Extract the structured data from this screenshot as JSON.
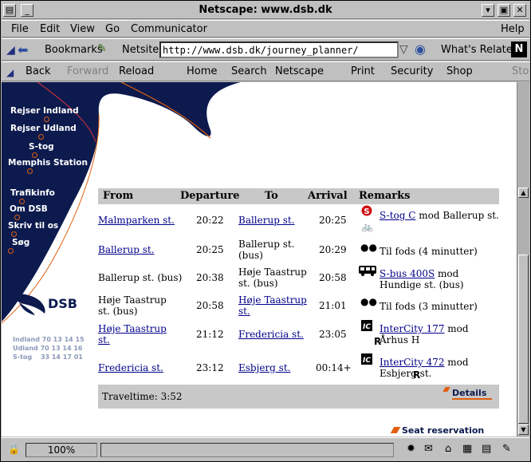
{
  "window": {
    "title": "Netscape: www.dsb.dk"
  },
  "menubar": {
    "items": [
      "File",
      "Edit",
      "View",
      "Go",
      "Communicator",
      "Help"
    ]
  },
  "location": {
    "bookmarks_label": "Bookmarks",
    "netsite_label": "Netsite:",
    "url": "http://www.dsb.dk/journey_planner/",
    "whats_related": "What's Related"
  },
  "nav": {
    "items": [
      "Back",
      "Forward",
      "Reload",
      "Home",
      "Search",
      "Netscape",
      "Print",
      "Security",
      "Shop",
      "Sto"
    ]
  },
  "sidebar": {
    "links": [
      "Rejser Indland",
      "Rejser Udland",
      "S-tog",
      "Memphis Station",
      "Trafikinfo",
      "Om DSB",
      "Skriv til os",
      "Søg"
    ],
    "logo_text": "DSB",
    "phones": [
      {
        "label": "Indland",
        "number": "70 13 14 15"
      },
      {
        "label": "Udland",
        "number": "70 13 14 16"
      },
      {
        "label": "S-tog",
        "number": "33 14 17 01"
      }
    ]
  },
  "table": {
    "headers": [
      "From",
      "Departure",
      "To",
      "Arrival",
      "Remarks"
    ],
    "rows": [
      {
        "from": "Malmparken st.",
        "dep": "20:22",
        "to": "Ballerup st.",
        "arr": "20:25",
        "remark_link": "S-tog C",
        "remark_text": " mod Ballerup st."
      },
      {
        "from": "Ballerup st.",
        "dep": "20:25",
        "to": "Ballerup st. (bus)",
        "arr": "20:29",
        "remark_link": "",
        "remark_text": "Til fods (4 minutter)"
      },
      {
        "from": "Ballerup st. (bus)",
        "dep": "20:38",
        "to": "Høje Taastrup st. (bus)",
        "arr": "20:58",
        "remark_link": "S-bus 400S",
        "remark_text": " mod Hundige st. (bus)"
      },
      {
        "from": "Høje Taastrup st. (bus)",
        "dep": "20:58",
        "to": "Høje Taastrup st.",
        "arr": "21:01",
        "remark_link": "",
        "remark_text": "Til fods (3 minutter)"
      },
      {
        "from": "Høje Taastrup st.",
        "dep": "21:12",
        "to": "Fredericia st.",
        "arr": "23:05",
        "remark_link": "InterCity 177",
        "remark_text": " mod Århus H",
        "remark_badge": "R"
      },
      {
        "from": "Fredericia st.",
        "dep": "23:12",
        "to": "Esbjerg st.",
        "arr": "00:14+",
        "remark_link": "InterCity 472",
        "remark_text": " mod Esbjerg st.",
        "remark_badge": "R"
      }
    ],
    "traveltime": "Traveltime: 3:52",
    "details_label": "Details",
    "seat_label": "Seat reservation"
  },
  "status": {
    "zoom": "100%"
  },
  "colors": {
    "navy": "#0c1a4e",
    "orange": "#e06010",
    "link": "#00008b",
    "header_bg": "#c8c8c8"
  }
}
